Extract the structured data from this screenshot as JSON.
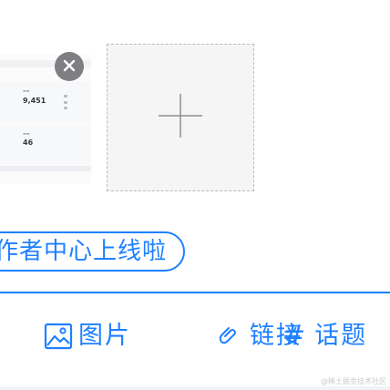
{
  "thumbnail": {
    "stat_1": "9,451",
    "stat_2": "46"
  },
  "toolbar": {
    "image_label": "图片",
    "link_label": "链接",
    "topic_label": "话题"
  },
  "topic_pill": {
    "text": "作者中心上线啦"
  },
  "icons": {
    "remove": "close-icon",
    "add": "plus-icon",
    "image": "image-icon",
    "link": "link-icon",
    "topic": "hash-icon"
  },
  "colors": {
    "accent": "#1e80ff",
    "remove_button": "#7f7f83",
    "placeholder_bg": "#f5f5f5",
    "placeholder_border": "#bcbcbc"
  },
  "watermark": "@稀土掘金技术社区"
}
